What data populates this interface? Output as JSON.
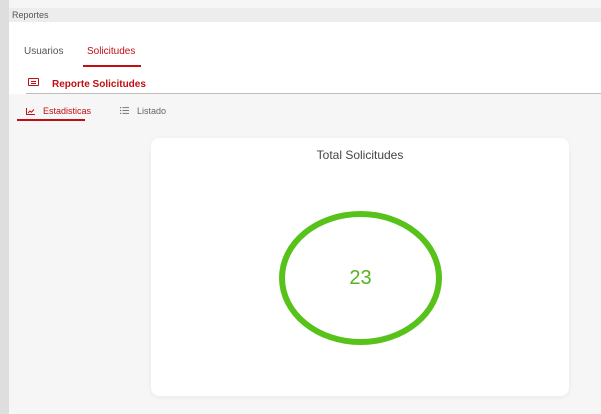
{
  "window": {
    "title": "Reportes"
  },
  "tabs": [
    {
      "label": "Usuarios",
      "active": false
    },
    {
      "label": "Solicitudes",
      "active": true
    }
  ],
  "report": {
    "label": "Reporte Solicitudes",
    "icon": "report-card-icon"
  },
  "subtabs": [
    {
      "label": "Estadisticas",
      "icon": "stats-chart-icon",
      "active": true
    },
    {
      "label": "Listado",
      "icon": "list-icon",
      "active": false
    }
  ],
  "card": {
    "title": "Total Solicitudes",
    "value": "23"
  },
  "colors": {
    "accent": "#c00e13",
    "ring": "#57c21a",
    "value": "#56b322"
  }
}
